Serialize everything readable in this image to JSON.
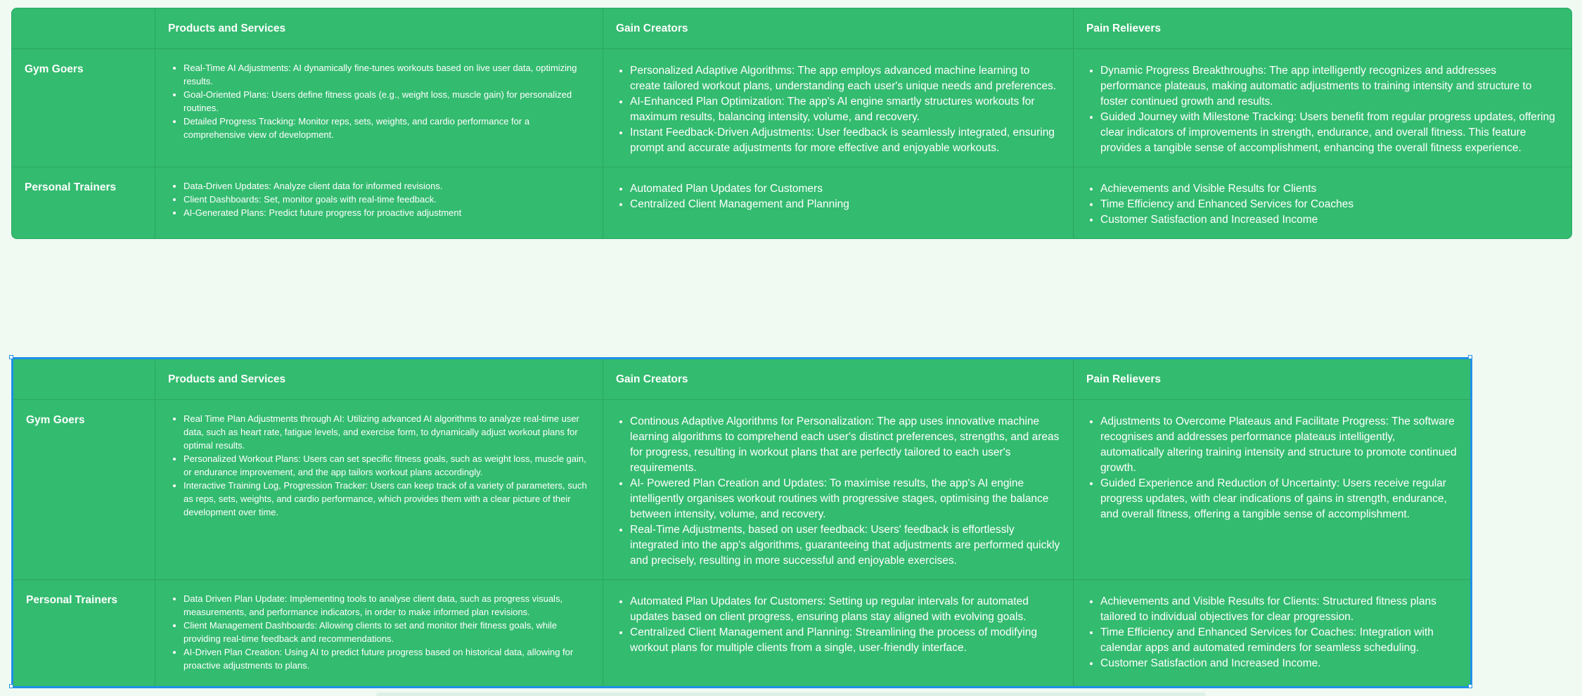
{
  "tables": [
    {
      "columns": [
        "",
        "Products and Services",
        "Gain Creators",
        "Pain Relievers"
      ],
      "rows": [
        {
          "label": "Gym Goers",
          "products": [
            "Real-Time AI Adjustments: AI dynamically fine-tunes workouts based on live user data, optimizing results.",
            "Goal-Oriented Plans: Users define fitness goals (e.g., weight loss, muscle gain) for personalized routines.",
            "Detailed Progress Tracking: Monitor reps, sets, weights, and cardio performance for a comprehensive view of development."
          ],
          "gains": [
            "Personalized Adaptive Algorithms: The app employs advanced machine learning to create tailored workout plans, understanding each user's unique needs and preferences.",
            "AI-Enhanced Plan Optimization: The app's AI engine smartly structures workouts for maximum results, balancing intensity, volume, and recovery.",
            "Instant Feedback-Driven Adjustments: User feedback is seamlessly integrated, ensuring prompt and accurate adjustments for more effective and enjoyable workouts."
          ],
          "pains": [
            "Dynamic Progress Breakthroughs: The app intelligently recognizes and addresses performance plateaus, making automatic adjustments to training intensity and structure to foster continued growth and results.",
            "Guided Journey with Milestone Tracking: Users benefit from regular progress updates, offering clear indicators of improvements in strength, endurance, and overall fitness. This feature provides a tangible sense of accomplishment, enhancing the overall fitness experience."
          ]
        },
        {
          "label": "Personal Trainers",
          "products": [
            "Data-Driven Updates: Analyze client data for informed revisions.",
            "Client Dashboards: Set, monitor goals with real-time feedback.",
            "AI-Generated Plans: Predict future progress for proactive adjustment"
          ],
          "gains": [
            "Automated Plan Updates for Customers",
            "Centralized Client Management and Planning"
          ],
          "pains": [
            "Achievements and Visible Results for Clients",
            "Time Efficiency and Enhanced Services for Coaches",
            "Customer Satisfaction and Increased Income"
          ]
        }
      ]
    },
    {
      "columns": [
        "",
        "Products and Services",
        "Gain Creators",
        "Pain Relievers"
      ],
      "rows": [
        {
          "label": "Gym Goers",
          "products": [
            "Real Time Plan Adjustments through AI: Utilizing advanced AI algorithms to analyze real-time user data, such as heart rate, fatigue levels, and exercise form, to dynamically adjust workout plans for optimal results.",
            "Personalized Workout Plans: Users can set specific fitness goals, such as weight loss, muscle gain, or endurance improvement, and the app tailors workout plans accordingly.",
            "Interactive Training Log, Progression Tracker: Users can keep track of a variety of parameters, such as reps, sets, weights, and cardio performance, which provides them with a clear picture of their development over time."
          ],
          "gains": [
            "Continous Adaptive Algorithms for Personalization: The app uses innovative machine learning algorithms to comprehend each user's distinct preferences, strengths, and areas for progress, resulting in workout plans that are perfectly tailored to each user's requirements.",
            "AI- Powered Plan Creation and Updates: To maximise results, the app's AI engine intelligently organises workout routines with progressive stages, optimising the balance between intensity, volume, and recovery.",
            "Real-Time Adjustments, based on user feedback: Users' feedback is effortlessly integrated into the app's algorithms, guaranteeing that adjustments are performed quickly and precisely, resulting in more successful and enjoyable exercises."
          ],
          "pains": [
            "Adjustments to Overcome Plateaus and Facilitate Progress: The software recognises and addresses performance plateaus intelligently, automatically altering training intensity and structure to promote continued growth.",
            "Guided Experience and Reduction of Uncertainty: Users receive regular progress updates, with clear indications of gains in strength, endurance, and overall fitness, offering a tangible sense of accomplishment."
          ]
        },
        {
          "label": "Personal Trainers",
          "products": [
            "Data Driven Plan Update: Implementing tools to analyse client data, such as progress visuals, measurements, and performance indicators, in order to make informed plan revisions.",
            "Client Management Dashboards: Allowing clients to set and monitor their fitness goals, while providing real-time feedback and recommendations.",
            "AI-Driven Plan Creation: Using AI to predict future progress based on historical data, allowing for proactive adjustments to plans."
          ],
          "gains": [
            "Automated Plan Updates for Customers: Setting up regular intervals for automated updates based on client progress, ensuring plans stay aligned with evolving goals.",
            "Centralized Client Management and Planning: Streamlining the process of modifying workout plans for multiple clients from a single, user-friendly interface."
          ],
          "pains": [
            "Achievements and Visible Results for Clients: Structured fitness plans tailored to individual objectives for clear progression.",
            "Time Efficiency and Enhanced Services for Coaches: Integration with calendar apps and automated reminders for seamless scheduling.",
            "Customer Satisfaction and Increased Income."
          ]
        }
      ]
    }
  ],
  "colors": {
    "background": "#f0faf3",
    "table_fill": "#33bb6f",
    "cell_border": "#2aa560",
    "selection_border": "#1f8fe6",
    "text": "#ffffff"
  }
}
